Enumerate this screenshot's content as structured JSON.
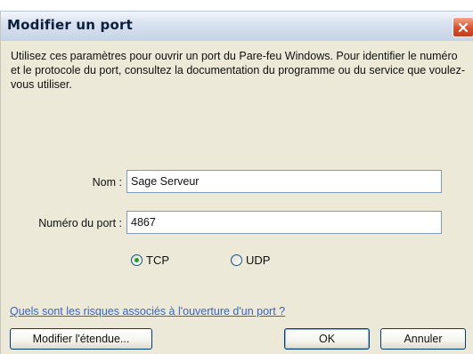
{
  "dialog": {
    "title": "Modifier un port",
    "description": "Utilisez ces paramètres pour ouvrir un port du Pare-feu Windows. Pour identifier le numéro et le protocole du port, consultez la documentation du programme ou du service que voulez-vous utiliser.",
    "name_label": "Nom :",
    "name_value": "Sage Serveur",
    "port_label": "Numéro du port :",
    "port_value": "4867",
    "protocol": {
      "tcp_label": "TCP",
      "udp_label": "UDP",
      "selected": "TCP"
    },
    "risk_link": "Quels sont les risques associés à l'ouverture d'un port ?",
    "buttons": {
      "scope": "Modifier l'étendue...",
      "ok": "OK",
      "cancel": "Annuler"
    }
  },
  "colors": {
    "accent_link": "#3366cc",
    "close_button": "#d8502c",
    "dialog_background": "#ece9d8"
  },
  "icons": {
    "close": "close-icon"
  }
}
